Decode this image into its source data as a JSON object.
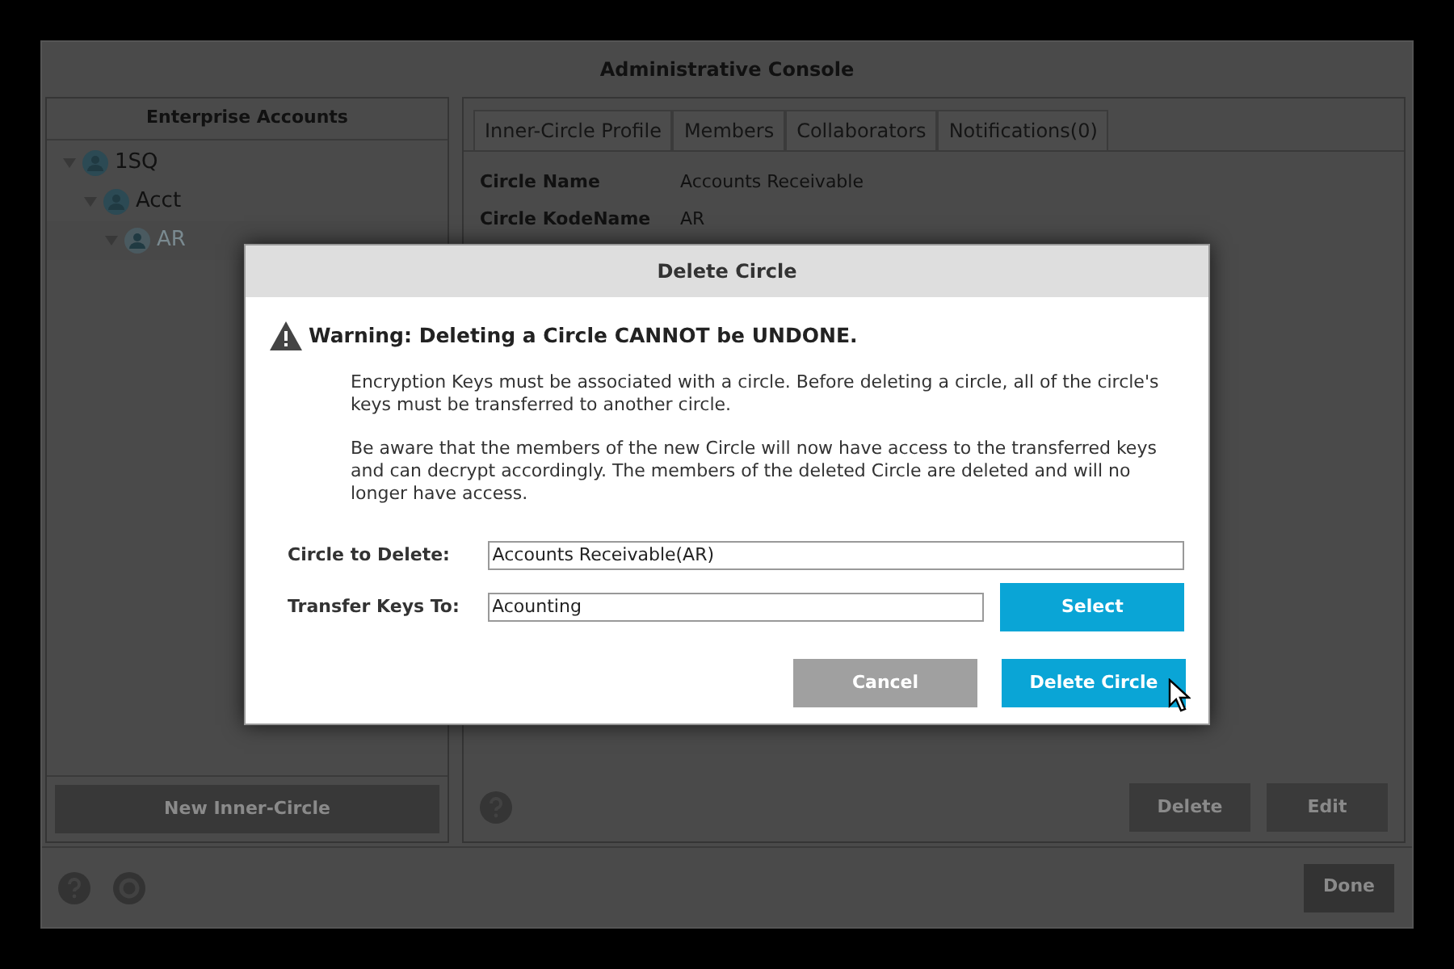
{
  "window": {
    "title": "Administrative Console"
  },
  "sidebar": {
    "header": "Enterprise Accounts",
    "tree": [
      {
        "label": "1SQ",
        "expanded": true,
        "selected": false,
        "children": [
          {
            "label": "Acct",
            "expanded": true,
            "selected": false,
            "children": [
              {
                "label": "AR",
                "expanded": true,
                "selected": true
              }
            ]
          }
        ]
      }
    ],
    "button": "New Inner-Circle"
  },
  "tabs": [
    {
      "label": "Inner-Circle Profile"
    },
    {
      "label": "Members"
    },
    {
      "label": "Collaborators"
    },
    {
      "label": "Notifications(0)"
    }
  ],
  "profile": [
    {
      "label": "Circle Name",
      "value": "Accounts Receivable"
    },
    {
      "label": "Circle KodeName",
      "value": "AR"
    }
  ],
  "panel_buttons": [
    "Delete",
    "Edit"
  ],
  "footer": {
    "button": "Done"
  },
  "dialog": {
    "title": "Delete Circle",
    "warning": "Warning: Deleting a Circle CANNOT be UNDONE.",
    "paragraphs": [
      "Encryption Keys must be associated with a circle. Before deleting a circle, all of the circle's keys must be transferred to another circle.",
      "Be aware that the members of the new Circle will now have access to the transferred keys and can decrypt accordingly.  The members of the deleted Circle are deleted and will no longer have access."
    ],
    "fields": [
      {
        "label": "Circle to Delete:",
        "value": "Accounts Receivable(AR)"
      },
      {
        "label": "Transfer Keys To:",
        "value": "Acounting",
        "button": "Select"
      }
    ],
    "buttons": [
      {
        "label": "Cancel",
        "kind": "secondary"
      },
      {
        "label": "Delete Circle",
        "kind": "primary"
      }
    ]
  }
}
